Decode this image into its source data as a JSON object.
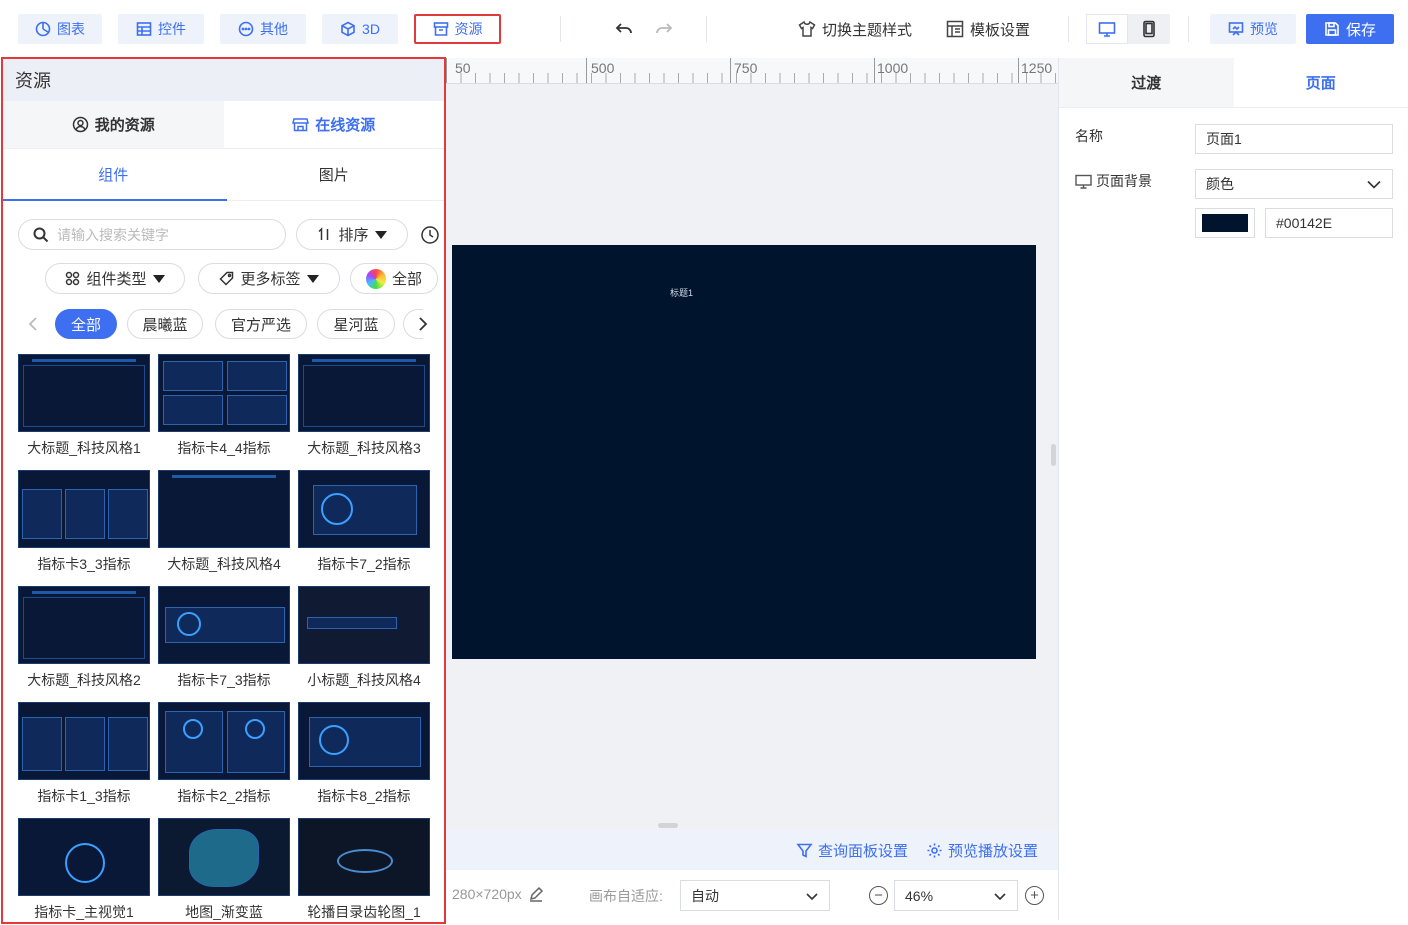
{
  "toolbar": {
    "chart_label": "图表",
    "widget_label": "控件",
    "other_label": "其他",
    "three_d_label": "3D",
    "resource_label": "资源",
    "theme_label": "切换主题样式",
    "template_label": "模板设置",
    "preview_label": "预览",
    "save_label": "保存"
  },
  "left_panel": {
    "title": "资源",
    "src_tabs": [
      "我的资源",
      "在线资源"
    ],
    "type_tabs": [
      "组件",
      "图片"
    ],
    "search_placeholder": "请输入搜索关键字",
    "sort_label": "排序",
    "component_type_label": "组件类型",
    "more_tags_label": "更多标签",
    "all_colors_label": "全部",
    "chips": [
      "全部",
      "晨曦蓝",
      "官方严选",
      "星河蓝"
    ],
    "cards": [
      "大标题_科技风格1",
      "指标卡4_4指标",
      "大标题_科技风格3",
      "指标卡3_3指标",
      "大标题_科技风格4",
      "指标卡7_2指标",
      "大标题_科技风格2",
      "指标卡7_3指标",
      "小标题_科技风格4",
      "指标卡1_3指标",
      "指标卡2_2指标",
      "指标卡8_2指标",
      "指标卡_主视觉1",
      "地图_渐变蓝",
      "轮播目录齿轮图_1"
    ]
  },
  "canvas": {
    "ruler_labels": [
      "50",
      "500",
      "750",
      "1000",
      "1250"
    ],
    "scene_title": "标题1",
    "scene_color": "#00142E",
    "query_panel_label": "查询面板设置",
    "preview_play_label": "预览播放设置",
    "size_text": "280×720px",
    "fit_label": "画布自适应:",
    "fit_value": "自动",
    "zoom_value": "46%"
  },
  "right_panel": {
    "tabs": [
      "过渡",
      "页面"
    ],
    "name_label": "名称",
    "name_value": "页面1",
    "bg_label": "页面背景",
    "bg_type": "颜色",
    "bg_hex": "#00142E"
  },
  "colors": {
    "accent": "#3D6FF0",
    "highlight_border": "#E23A3A"
  }
}
